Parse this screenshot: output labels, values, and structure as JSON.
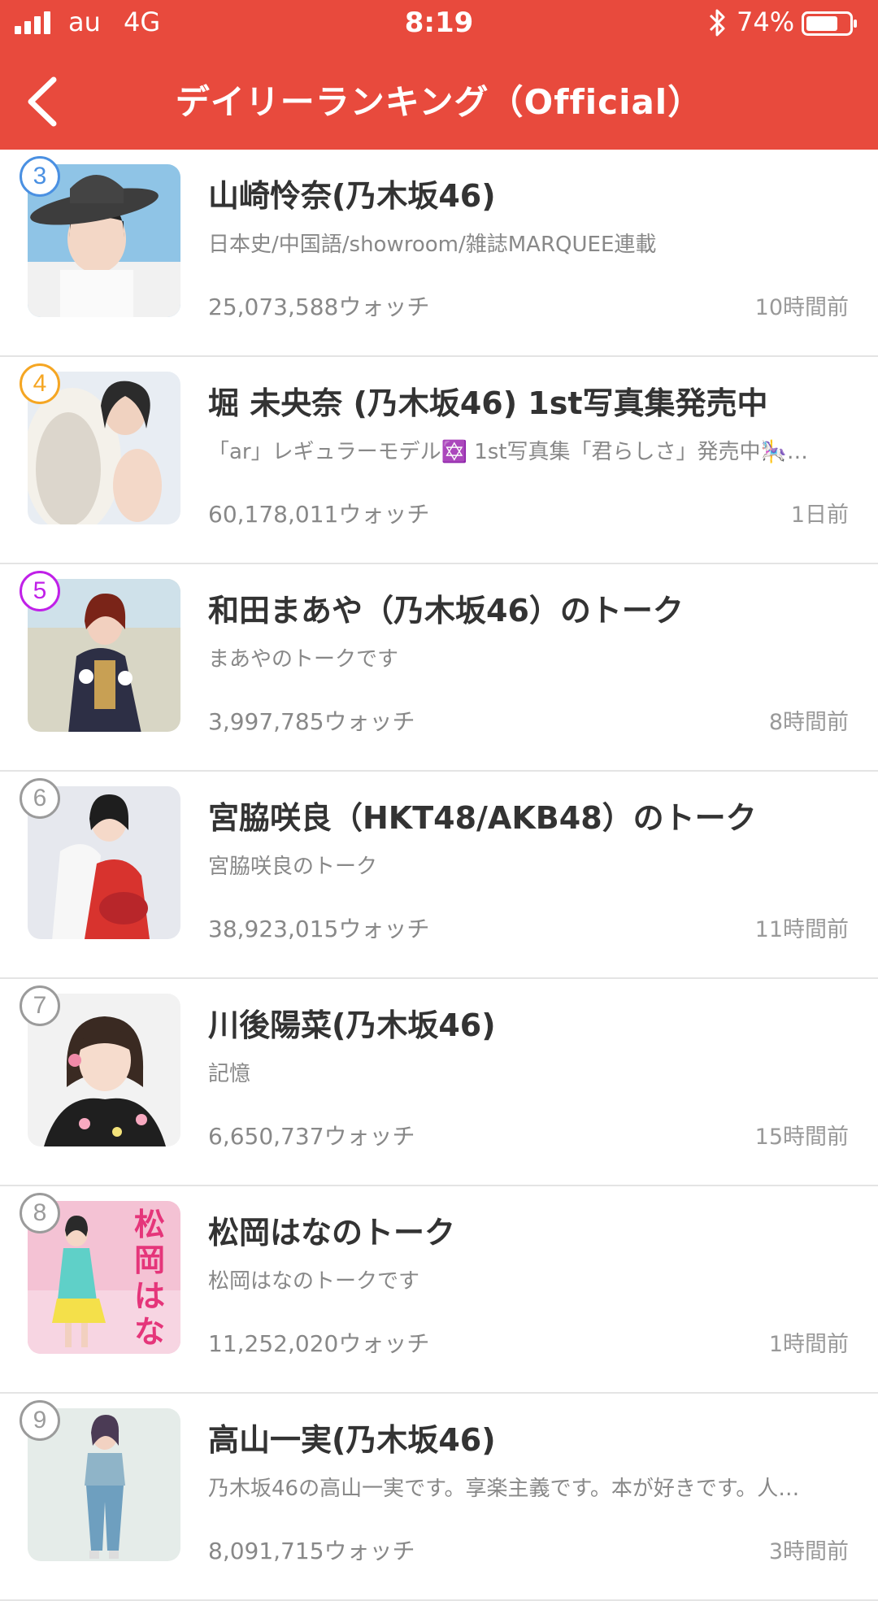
{
  "status_bar": {
    "carrier": "au",
    "network": "4G",
    "time": "8:19",
    "battery_percent": "74%",
    "battery_level": 0.74
  },
  "header": {
    "title": "デイリーランキング（Official）",
    "back_icon": "chevron-left-icon",
    "background_color": "#e84a3d"
  },
  "items": [
    {
      "rank": "3",
      "rank_color": "#4a90e2",
      "name": "山崎怜奈(乃木坂46)",
      "description": "日本史/中国語/showroom/雑誌MARQUEE連載",
      "watches": "25,073,588ウォッチ",
      "time": "10時間前"
    },
    {
      "rank": "4",
      "rank_color": "#f5a623",
      "name": "堀 未央奈 (乃木坂46) 1st写真集発売中",
      "description": "「ar」レギュラーモデル✡️ 1st写真集「君らしさ」発売中🎠…",
      "watches": "60,178,011ウォッチ",
      "time": "1日前"
    },
    {
      "rank": "5",
      "rank_color": "#c020e8",
      "name": "和田まあや（乃木坂46）のトーク",
      "description": "まあやのトークです",
      "watches": "3,997,785ウォッチ",
      "time": "8時間前"
    },
    {
      "rank": "6",
      "rank_color": "#9b9b9b",
      "name": "宮脇咲良（HKT48/AKB48）のトーク",
      "description": "宮脇咲良のトーク",
      "watches": "38,923,015ウォッチ",
      "time": "11時間前"
    },
    {
      "rank": "7",
      "rank_color": "#9b9b9b",
      "name": "川後陽菜(乃木坂46)",
      "description": "記憶",
      "watches": "6,650,737ウォッチ",
      "time": "15時間前"
    },
    {
      "rank": "8",
      "rank_color": "#9b9b9b",
      "name": "松岡はなのトーク",
      "description": "松岡はなのトークです",
      "watches": "11,252,020ウォッチ",
      "time": "1時間前",
      "thumb_text": "松岡はな"
    },
    {
      "rank": "9",
      "rank_color": "#9b9b9b",
      "name": "高山一実(乃木坂46)",
      "description": "乃木坂46の高山一実です。享楽主義です。本が好きです。人…",
      "watches": "8,091,715ウォッチ",
      "time": "3時間前"
    }
  ]
}
